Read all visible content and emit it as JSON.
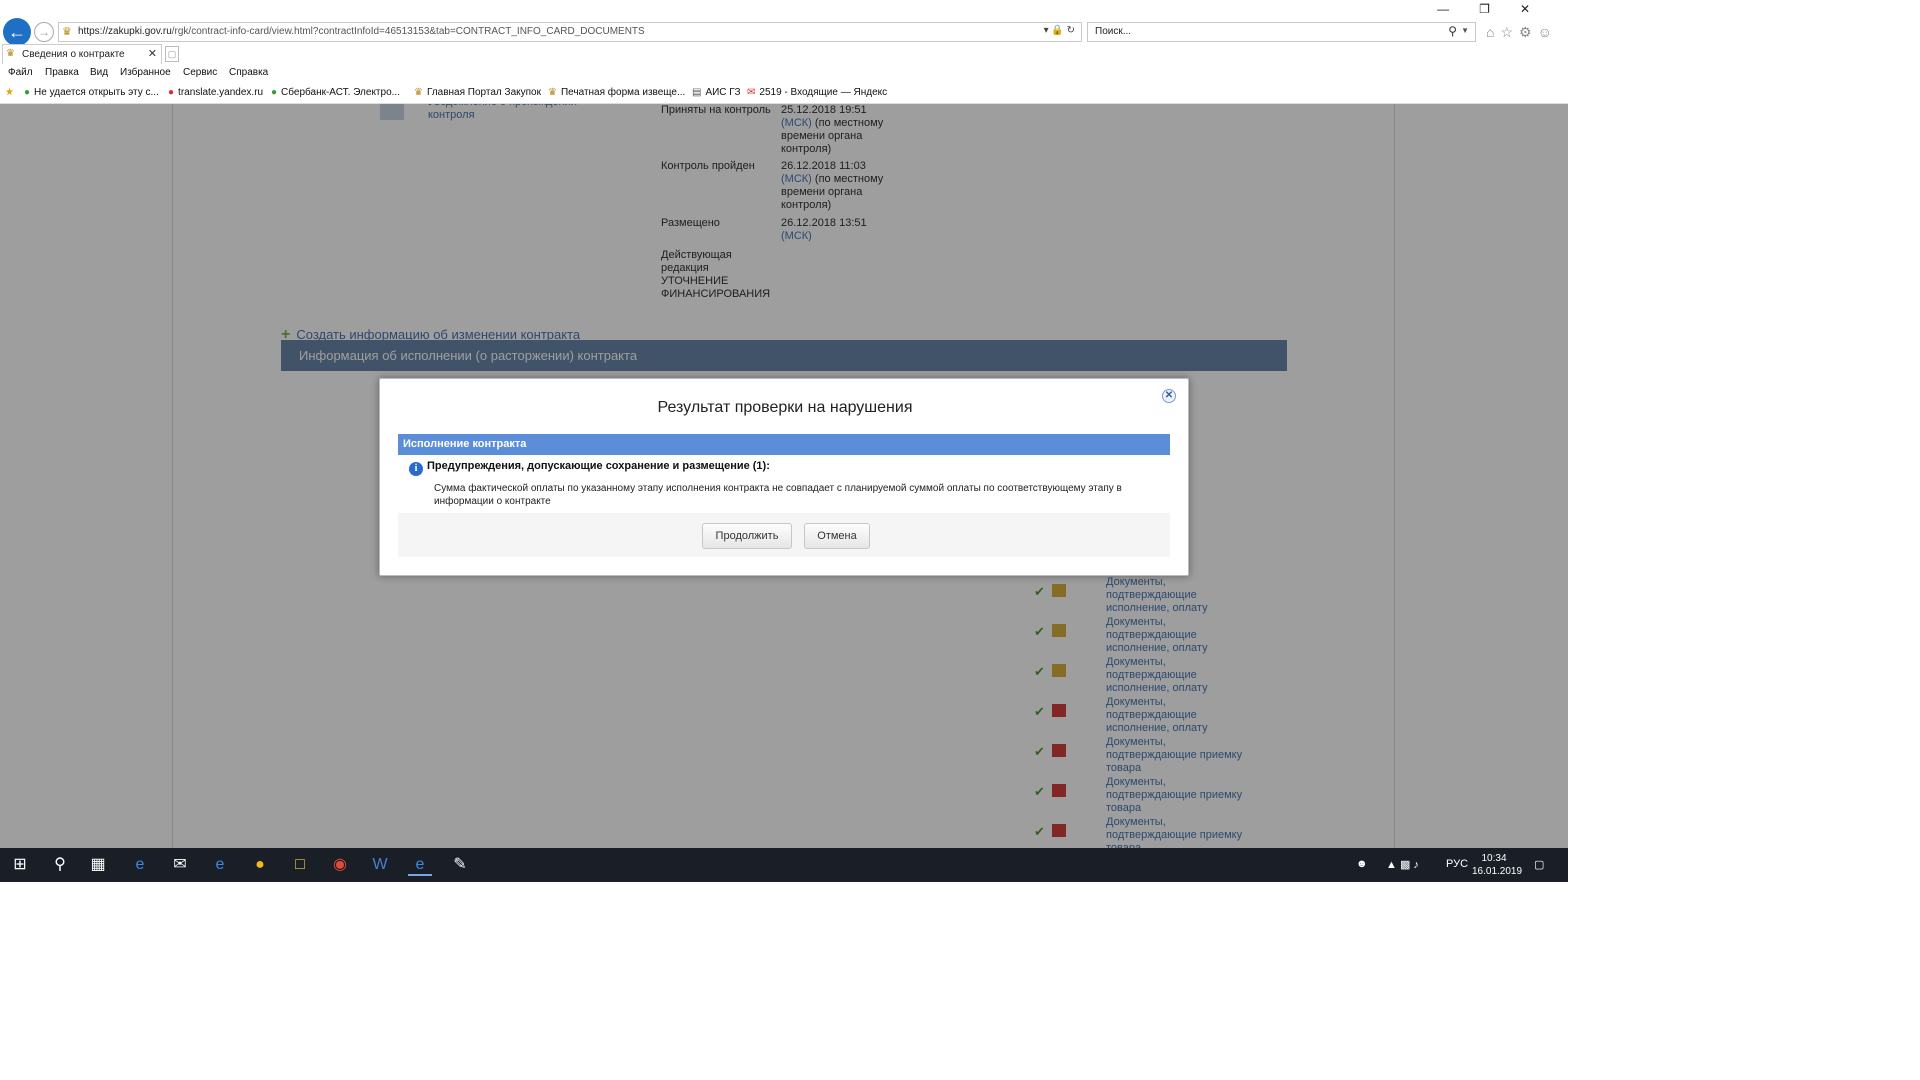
{
  "browser": {
    "url_main": "https://zakupki.gov.ru",
    "url_rest": "/rgk/contract-info-card/view.html?contractInfoId=46513153&tab=CONTRACT_INFO_CARD_DOCUMENTS",
    "search_placeholder": "Поиск...",
    "tab_title": "Сведения о контракте",
    "menu": [
      "Файл",
      "Правка",
      "Вид",
      "Избранное",
      "Сервис",
      "Справка"
    ],
    "favorites": [
      "Не удается открыть эту с...",
      "translate.yandex.ru",
      "Сбербанк-АСТ. Электро...",
      "Главная Портал Закупок",
      "Печатная форма извеще...",
      "АИС ГЗ",
      "2519 - Входящие — Яндекс"
    ]
  },
  "page": {
    "side_link": "Уведомление о прохождении контроля",
    "info_rows": [
      {
        "label": "Приняты на контроль",
        "value": "25.12.2018 19:51",
        "tz": "(МСК)",
        "note": "(по местному времени органа контроля)"
      },
      {
        "label": "Контроль пройден",
        "value": "26.12.2018 11:03",
        "tz": "(МСК)",
        "note": "(по местному времени органа контроля)"
      },
      {
        "label": "Размещено",
        "value": "26.12.2018 13:51",
        "tz": "(МСК)",
        "note": ""
      },
      {
        "label": "Действующая редакция УТОЧНЕНИЕ ФИНАНСИРОВАНИЯ",
        "value": "",
        "tz": "",
        "note": ""
      }
    ],
    "create_link": "Создать информацию об изменении контракта",
    "section_title": "Информация об исполнении (о расторжении) контракта",
    "documents": [
      "Документы, подтверждающие исполнение, оплату",
      "Документы, подтверждающие исполнение, оплату",
      "Документы, подтверждающие исполнение, оплату",
      "Документы, подтверждающие исполнение, оплату",
      "Документы, подтверждающие приемку товара",
      "Документы, подтверждающие приемку товара",
      "Документы, подтверждающие приемку товара"
    ]
  },
  "dialog": {
    "title": "Результат проверки на нарушения",
    "section": "Исполнение контракта",
    "warning_heading": "Предупреждения, допускающие сохранение и размещение (1):",
    "warning_text": "Сумма фактической оплаты по указанному этапу исполнения контракта не совпадает с планируемой суммой оплаты по соответствующему этапу в информации о контракте",
    "continue_label": "Продолжить",
    "cancel_label": "Отмена"
  },
  "taskbar": {
    "lang": "РУС",
    "time": "10:34",
    "date": "16.01.2019"
  },
  "colors": {
    "accent": "#5b8dd9",
    "section_header": "#6a86aa",
    "link": "#4a76b2"
  }
}
